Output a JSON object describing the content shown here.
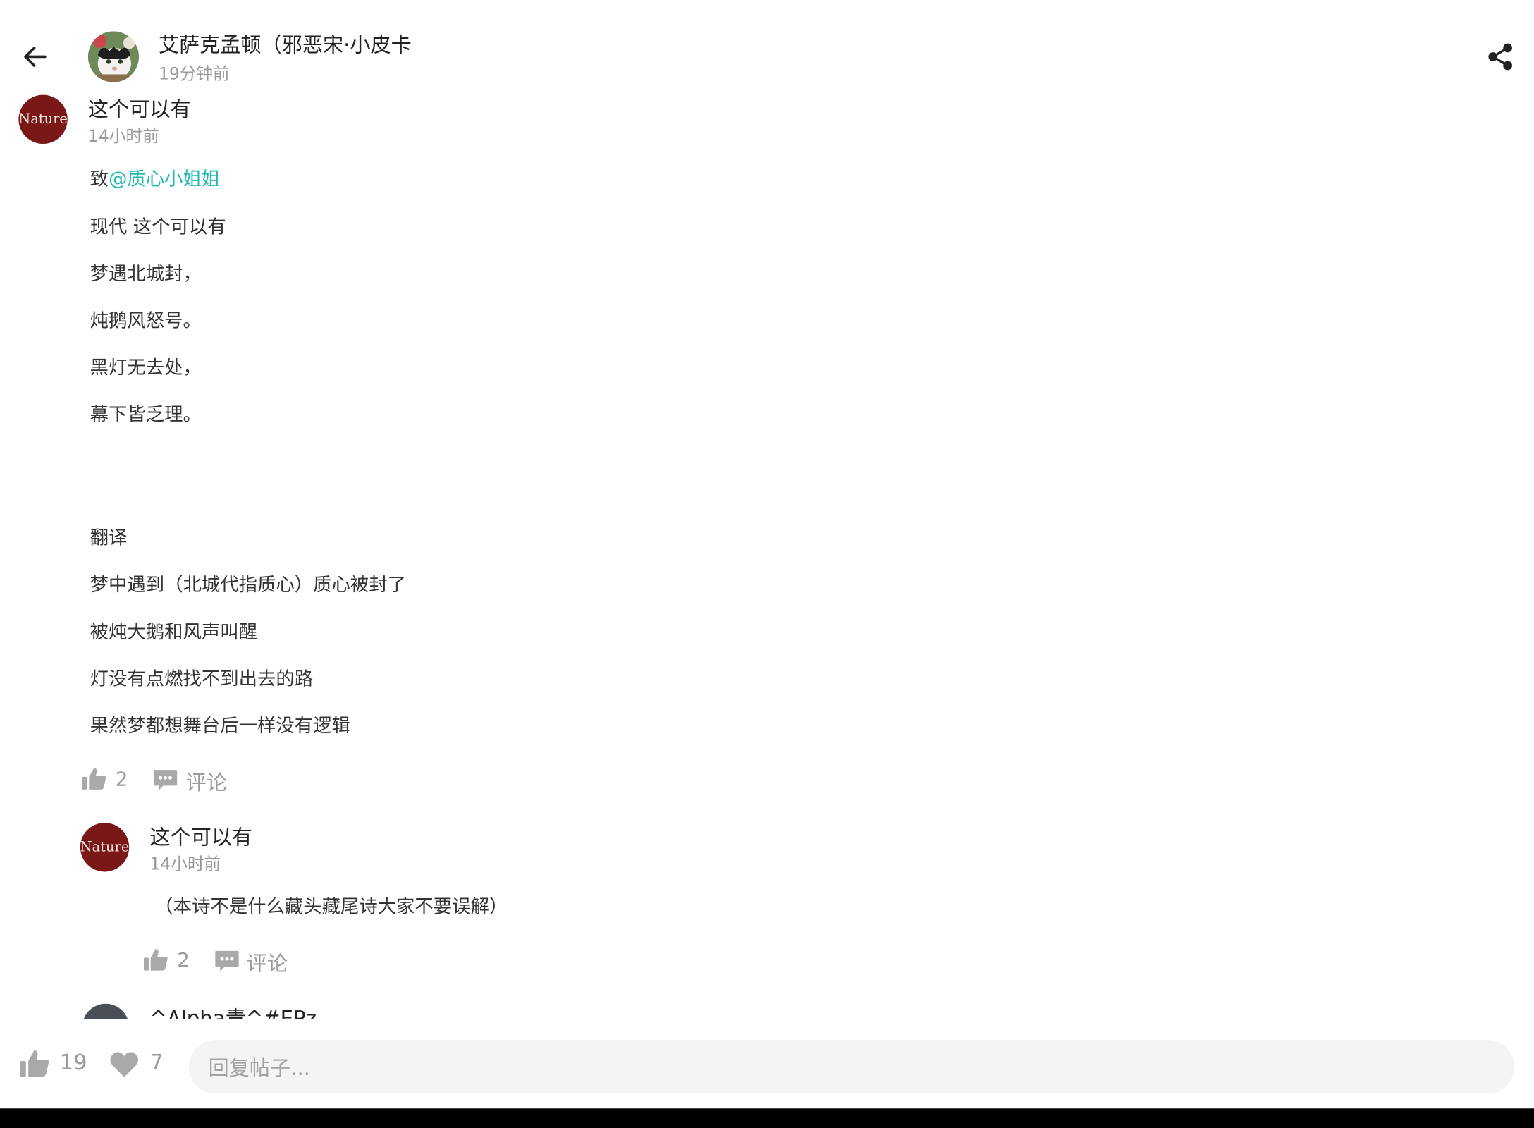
{
  "header": {
    "title": "艾萨克孟顿（邪恶宋·小皮卡",
    "time": "19分钟前"
  },
  "post": {
    "avatar_text": "Nature",
    "author": "这个可以有",
    "time": "14小时前",
    "mention_prefix": "致",
    "mention": "@质心小姐姐",
    "lines": [
      "现代 这个可以有",
      "梦遇北城封，",
      "炖鹅风怒号。",
      "黑灯无去处，",
      "幕下皆乏理。",
      "翻译",
      "梦中遇到（北城代指质心）质心被封了",
      "被炖大鹅和风声叫醒",
      "灯没有点燃找不到出去的路",
      "果然梦都想舞台后一样没有逻辑"
    ],
    "like_count": "2",
    "comment_label": "评论"
  },
  "reply": {
    "avatar_text": "Nature",
    "author": "这个可以有",
    "time": "14小时前",
    "text": "（本诗不是什么藏头藏尾诗大家不要误解）",
    "like_count": "2",
    "comment_label": "评论"
  },
  "next_reply": {
    "author": "^Alpha责^#EPz"
  },
  "bottom": {
    "like_count": "19",
    "favorite_count": "7",
    "reply_placeholder": "回复帖子..."
  },
  "colors": {
    "mention": "#1fb9b3",
    "avatar_bg": "#7a1717",
    "muted": "#9a9a9a"
  },
  "icons": [
    "back-arrow-icon",
    "share-icon",
    "thumbs-up-icon",
    "comment-icon",
    "heart-icon"
  ]
}
